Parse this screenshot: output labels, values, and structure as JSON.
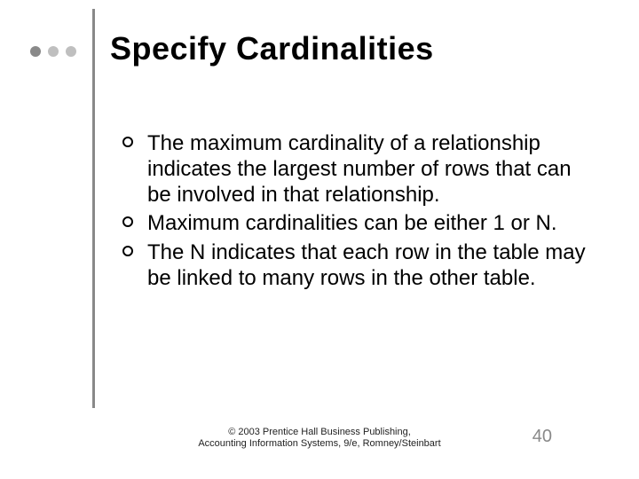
{
  "title": "Specify Cardinalities",
  "bullets": [
    "The maximum cardinality of a relationship indicates the largest number of rows that can be involved in that relationship.",
    "Maximum cardinalities can be either 1 or N.",
    "The N indicates that each row in the table may be linked to many rows in the other table."
  ],
  "footer": {
    "line1": "© 2003 Prentice Hall Business Publishing,",
    "line2": "Accounting Information Systems, 9/e, Romney/Steinbart"
  },
  "page_number": "40"
}
